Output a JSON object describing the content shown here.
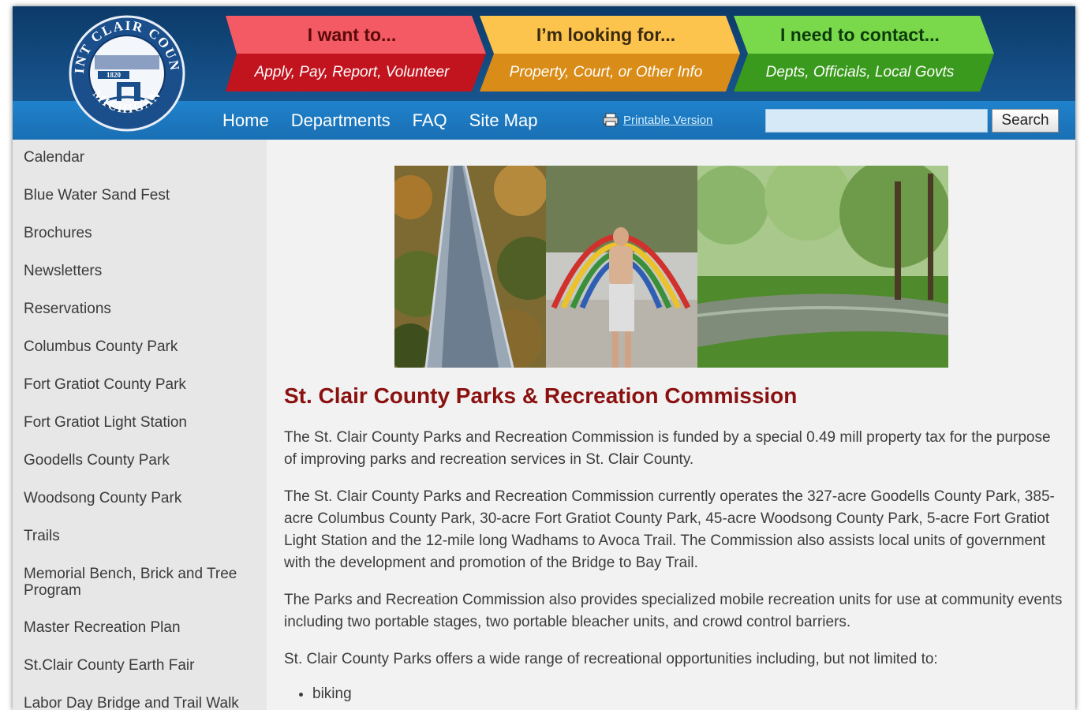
{
  "header": {
    "seal_text": {
      "top": "SAINT CLAIR COUNTY",
      "year": "1820",
      "bottom": "MICHIGAN"
    },
    "banners": [
      {
        "title": "I want to...",
        "subtitle": "Apply, Pay, Report, Volunteer",
        "color_top": "#f35a63",
        "color_bottom": "#c2141e"
      },
      {
        "title": "I’m looking for...",
        "subtitle": "Property, Court, or Other Info",
        "color_top": "#fcc34d",
        "color_bottom": "#d98c17"
      },
      {
        "title": "I need to contact...",
        "subtitle": "Depts, Officials, Local Govts",
        "color_top": "#7ad94a",
        "color_bottom": "#3a9a1d"
      }
    ],
    "nav": [
      "Home",
      "Departments",
      "FAQ",
      "Site Map"
    ],
    "printable_label": "Printable Version",
    "search_value": "",
    "search_button": "Search"
  },
  "sidebar": {
    "items": [
      "Calendar",
      "Blue Water Sand Fest",
      "Brochures",
      "Newsletters",
      "Reservations",
      "Columbus County Park",
      "Fort Gratiot County Park",
      "Fort Gratiot Light Station",
      "Goodells County Park",
      "Woodsong County Park",
      "Trails",
      "Memorial Bench, Brick and Tree Program",
      "Master Recreation Plan",
      "St.Clair County Earth Fair",
      "Labor Day Bridge and Trail Walk"
    ]
  },
  "main": {
    "title": "St. Clair County Parks & Recreation Commission",
    "paragraphs": [
      "The St. Clair County Parks and Recreation Commission is funded by a special 0.49 mill property tax for the purpose of improving parks and recreation services in St. Clair County.",
      "The St. Clair County Parks and Recreation Commission currently operates the 327-acre Goodells County Park, 385-acre Columbus County Park, 30-acre Fort Gratiot County Park, 45-acre Woodsong County Park, 5-acre Fort Gratiot Light Station and the 12-mile long Wadhams to Avoca Trail. The Commission also assists local units of government with the development and promotion of the Bridge to Bay Trail.",
      "The Parks and Recreation Commission also provides specialized mobile recreation units for use at community events including two portable stages, two portable bleacher units, and crowd control barriers.",
      "St. Clair County Parks offers a wide range of recreational opportunities including, but not limited to:"
    ],
    "list": [
      "biking"
    ]
  },
  "colors": {
    "header_dark": "#0c3a68",
    "nav_bar": "#1f82cc",
    "title_red": "#8b1111",
    "sidebar_bg": "#e6e7e6",
    "content_bg": "#f1f2f1"
  }
}
